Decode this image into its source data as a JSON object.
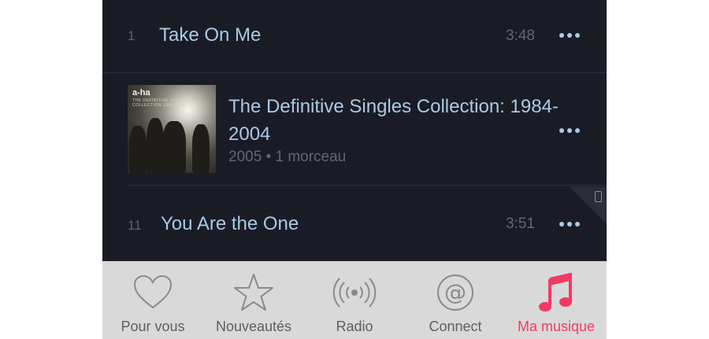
{
  "tracks": [
    {
      "number": "1",
      "title": "Take On Me",
      "duration": "3:48"
    },
    {
      "number": "11",
      "title": "You Are the One",
      "duration": "3:51"
    }
  ],
  "album": {
    "title": "The Definitive Singles Collection: 1984-2004",
    "meta": "2005 • 1 morceau",
    "cover_logo": "a-ha",
    "cover_subtitle": "THE DEFINITIVE SINGLES COLLECTION 1984-2004"
  },
  "tabbar": {
    "items": [
      {
        "label": "Pour vous",
        "icon": "heart-icon"
      },
      {
        "label": "Nouveautés",
        "icon": "star-icon"
      },
      {
        "label": "Radio",
        "icon": "radio-icon"
      },
      {
        "label": "Connect",
        "icon": "at-icon"
      },
      {
        "label": "Ma musique",
        "icon": "music-note-icon",
        "active": true
      }
    ]
  },
  "colors": {
    "background": "#1a1c25",
    "title_text": "#a9cbe5",
    "muted_text": "#5f6775",
    "tabbar_bg": "#d9d9d9",
    "accent": "#f13a63"
  }
}
